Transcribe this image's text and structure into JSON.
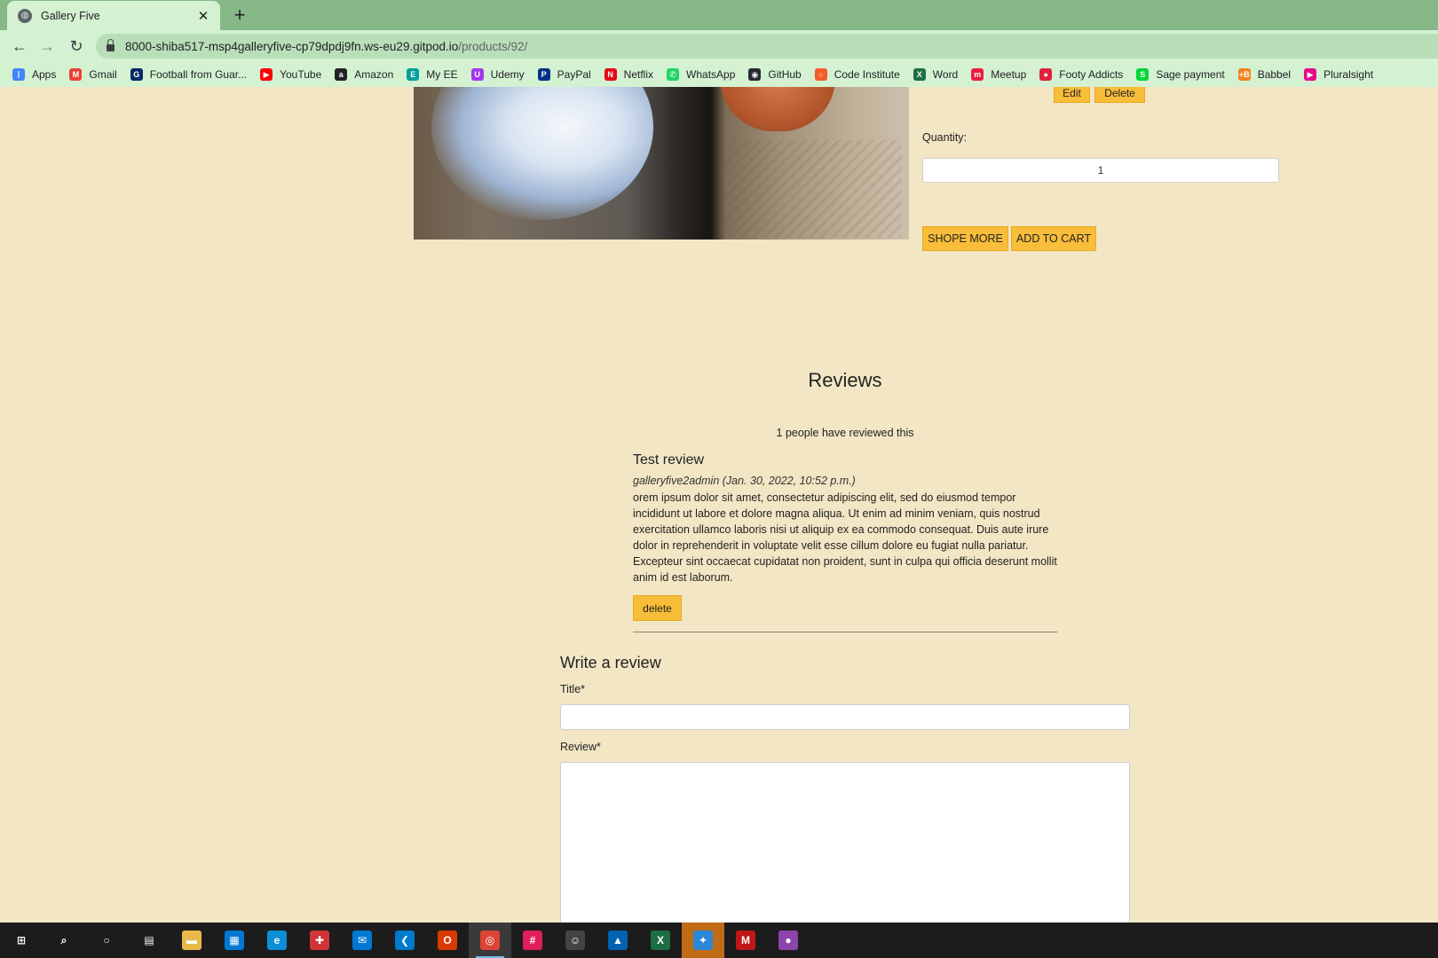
{
  "browser": {
    "tab_title": "Gallery Five",
    "tab_close": "✕",
    "new_tab": "+",
    "back": "←",
    "forward": "→",
    "reload": "↻",
    "url_host": "8000-shiba517-msp4galleryfive-cp79dpdj9fn.ws-eu29.gitpod.io",
    "url_path": "/products/92/",
    "bookmarks": [
      {
        "label": "Apps",
        "icon": "apps-grid-icon",
        "color": "#4285f4",
        "glyph": "⋮"
      },
      {
        "label": "Gmail",
        "icon": "gmail-icon",
        "color": "#ea4335",
        "glyph": "M"
      },
      {
        "label": "Football from Guar...",
        "icon": "guardian-icon",
        "color": "#052962",
        "glyph": "G"
      },
      {
        "label": "YouTube",
        "icon": "youtube-icon",
        "color": "#ff0000",
        "glyph": "▶"
      },
      {
        "label": "Amazon",
        "icon": "amazon-icon",
        "color": "#222222",
        "glyph": "a"
      },
      {
        "label": "My EE",
        "icon": "ee-icon",
        "color": "#00a19a",
        "glyph": "E"
      },
      {
        "label": "Udemy",
        "icon": "udemy-icon",
        "color": "#a435f0",
        "glyph": "U"
      },
      {
        "label": "PayPal",
        "icon": "paypal-icon",
        "color": "#003087",
        "glyph": "P"
      },
      {
        "label": "Netflix",
        "icon": "netflix-icon",
        "color": "#e50914",
        "glyph": "N"
      },
      {
        "label": "WhatsApp",
        "icon": "whatsapp-icon",
        "color": "#25d366",
        "glyph": "✆"
      },
      {
        "label": "GitHub",
        "icon": "github-icon",
        "color": "#24292e",
        "glyph": "◉"
      },
      {
        "label": "Code Institute",
        "icon": "code-institute-icon",
        "color": "#f45b2a",
        "glyph": "○"
      },
      {
        "label": "Word",
        "icon": "word-icon",
        "color": "#1d6f42",
        "glyph": "X"
      },
      {
        "label": "Meetup",
        "icon": "meetup-icon",
        "color": "#ed1c40",
        "glyph": "m"
      },
      {
        "label": "Footy Addicts",
        "icon": "footy-addicts-icon",
        "color": "#e0213c",
        "glyph": "●"
      },
      {
        "label": "Sage payment",
        "icon": "sage-icon",
        "color": "#00d639",
        "glyph": "S"
      },
      {
        "label": "Babbel",
        "icon": "babbel-icon",
        "color": "#f58220",
        "glyph": "+B"
      },
      {
        "label": "Pluralsight",
        "icon": "pluralsight-icon",
        "color": "#e80a89",
        "glyph": "▶"
      }
    ]
  },
  "product": {
    "edit_label": "Edit",
    "delete_label": "Delete",
    "quantity_label": "Quantity:",
    "quantity_value": "1",
    "shop_more_label": "SHOPE MORE",
    "add_to_cart_label": "ADD TO CART"
  },
  "reviews": {
    "heading": "Reviews",
    "count_text": "1 people have reviewed this",
    "items": [
      {
        "title": "Test review",
        "meta": "galleryfive2admin (Jan. 30, 2022, 10:52 p.m.)",
        "body": "orem ipsum dolor sit amet, consectetur adipiscing elit, sed do eiusmod tempor incididunt ut labore et dolore magna aliqua. Ut enim ad minim veniam, quis nostrud exercitation ullamco laboris nisi ut aliquip ex ea commodo consequat. Duis aute irure dolor in reprehenderit in voluptate velit esse cillum dolore eu fugiat nulla pariatur. Excepteur sint occaecat cupidatat non proident, sunt in culpa qui officia deserunt mollit anim id est laborum.",
        "delete_label": "delete"
      }
    ]
  },
  "write_review": {
    "heading": "Write a review",
    "title_label": "Title*",
    "review_label": "Review*"
  },
  "taskbar": {
    "items": [
      {
        "name": "start-icon",
        "glyph": "⊞",
        "color": "#1c1c1c"
      },
      {
        "name": "search-icon",
        "glyph": "⌕",
        "color": "#1c1c1c"
      },
      {
        "name": "cortana-icon",
        "glyph": "○",
        "color": "#1c1c1c"
      },
      {
        "name": "task-view-icon",
        "glyph": "▤",
        "color": "#1c1c1c"
      },
      {
        "name": "file-explorer-icon",
        "glyph": "▬",
        "color": "#e8b84a"
      },
      {
        "name": "store-icon",
        "glyph": "▦",
        "color": "#0078d4"
      },
      {
        "name": "edge-icon",
        "glyph": "e",
        "color": "#0c8fd6"
      },
      {
        "name": "gift-icon",
        "glyph": "✚",
        "color": "#d13438"
      },
      {
        "name": "mail-icon",
        "glyph": "✉",
        "color": "#0078d4"
      },
      {
        "name": "vscode-icon",
        "glyph": "❮",
        "color": "#007acc"
      },
      {
        "name": "office-icon",
        "glyph": "O",
        "color": "#d83b01"
      },
      {
        "name": "chrome-icon",
        "glyph": "◎",
        "color": "#db4437"
      },
      {
        "name": "slack-icon",
        "glyph": "#",
        "color": "#e01e5a"
      },
      {
        "name": "emoji-icon",
        "glyph": "☺",
        "color": "#444444"
      },
      {
        "name": "photos-icon",
        "glyph": "▲",
        "color": "#0063b1"
      },
      {
        "name": "excel-icon",
        "glyph": "X",
        "color": "#1d6f42"
      },
      {
        "name": "shield-icon",
        "glyph": "✦",
        "color": "#2b88d8"
      },
      {
        "name": "mcafee-icon",
        "glyph": "M",
        "color": "#c01818"
      },
      {
        "name": "paint-drop-icon",
        "glyph": "●",
        "color": "#8e44ad"
      }
    ]
  }
}
